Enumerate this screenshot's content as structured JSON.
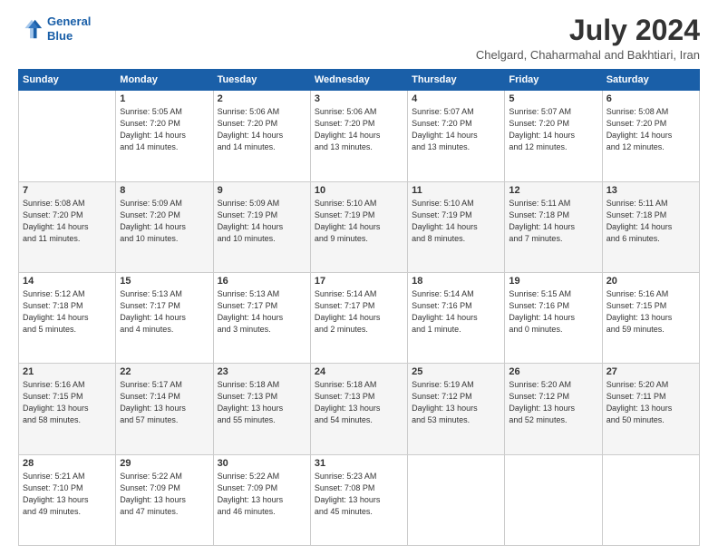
{
  "logo": {
    "line1": "General",
    "line2": "Blue"
  },
  "title": "July 2024",
  "location": "Chelgard, Chaharmahal and Bakhtiari, Iran",
  "headers": [
    "Sunday",
    "Monday",
    "Tuesday",
    "Wednesday",
    "Thursday",
    "Friday",
    "Saturday"
  ],
  "weeks": [
    [
      {
        "day": "",
        "info": ""
      },
      {
        "day": "1",
        "info": "Sunrise: 5:05 AM\nSunset: 7:20 PM\nDaylight: 14 hours\nand 14 minutes."
      },
      {
        "day": "2",
        "info": "Sunrise: 5:06 AM\nSunset: 7:20 PM\nDaylight: 14 hours\nand 14 minutes."
      },
      {
        "day": "3",
        "info": "Sunrise: 5:06 AM\nSunset: 7:20 PM\nDaylight: 14 hours\nand 13 minutes."
      },
      {
        "day": "4",
        "info": "Sunrise: 5:07 AM\nSunset: 7:20 PM\nDaylight: 14 hours\nand 13 minutes."
      },
      {
        "day": "5",
        "info": "Sunrise: 5:07 AM\nSunset: 7:20 PM\nDaylight: 14 hours\nand 12 minutes."
      },
      {
        "day": "6",
        "info": "Sunrise: 5:08 AM\nSunset: 7:20 PM\nDaylight: 14 hours\nand 12 minutes."
      }
    ],
    [
      {
        "day": "7",
        "info": "Sunrise: 5:08 AM\nSunset: 7:20 PM\nDaylight: 14 hours\nand 11 minutes."
      },
      {
        "day": "8",
        "info": "Sunrise: 5:09 AM\nSunset: 7:20 PM\nDaylight: 14 hours\nand 10 minutes."
      },
      {
        "day": "9",
        "info": "Sunrise: 5:09 AM\nSunset: 7:19 PM\nDaylight: 14 hours\nand 10 minutes."
      },
      {
        "day": "10",
        "info": "Sunrise: 5:10 AM\nSunset: 7:19 PM\nDaylight: 14 hours\nand 9 minutes."
      },
      {
        "day": "11",
        "info": "Sunrise: 5:10 AM\nSunset: 7:19 PM\nDaylight: 14 hours\nand 8 minutes."
      },
      {
        "day": "12",
        "info": "Sunrise: 5:11 AM\nSunset: 7:18 PM\nDaylight: 14 hours\nand 7 minutes."
      },
      {
        "day": "13",
        "info": "Sunrise: 5:11 AM\nSunset: 7:18 PM\nDaylight: 14 hours\nand 6 minutes."
      }
    ],
    [
      {
        "day": "14",
        "info": "Sunrise: 5:12 AM\nSunset: 7:18 PM\nDaylight: 14 hours\nand 5 minutes."
      },
      {
        "day": "15",
        "info": "Sunrise: 5:13 AM\nSunset: 7:17 PM\nDaylight: 14 hours\nand 4 minutes."
      },
      {
        "day": "16",
        "info": "Sunrise: 5:13 AM\nSunset: 7:17 PM\nDaylight: 14 hours\nand 3 minutes."
      },
      {
        "day": "17",
        "info": "Sunrise: 5:14 AM\nSunset: 7:17 PM\nDaylight: 14 hours\nand 2 minutes."
      },
      {
        "day": "18",
        "info": "Sunrise: 5:14 AM\nSunset: 7:16 PM\nDaylight: 14 hours\nand 1 minute."
      },
      {
        "day": "19",
        "info": "Sunrise: 5:15 AM\nSunset: 7:16 PM\nDaylight: 14 hours\nand 0 minutes."
      },
      {
        "day": "20",
        "info": "Sunrise: 5:16 AM\nSunset: 7:15 PM\nDaylight: 13 hours\nand 59 minutes."
      }
    ],
    [
      {
        "day": "21",
        "info": "Sunrise: 5:16 AM\nSunset: 7:15 PM\nDaylight: 13 hours\nand 58 minutes."
      },
      {
        "day": "22",
        "info": "Sunrise: 5:17 AM\nSunset: 7:14 PM\nDaylight: 13 hours\nand 57 minutes."
      },
      {
        "day": "23",
        "info": "Sunrise: 5:18 AM\nSunset: 7:13 PM\nDaylight: 13 hours\nand 55 minutes."
      },
      {
        "day": "24",
        "info": "Sunrise: 5:18 AM\nSunset: 7:13 PM\nDaylight: 13 hours\nand 54 minutes."
      },
      {
        "day": "25",
        "info": "Sunrise: 5:19 AM\nSunset: 7:12 PM\nDaylight: 13 hours\nand 53 minutes."
      },
      {
        "day": "26",
        "info": "Sunrise: 5:20 AM\nSunset: 7:12 PM\nDaylight: 13 hours\nand 52 minutes."
      },
      {
        "day": "27",
        "info": "Sunrise: 5:20 AM\nSunset: 7:11 PM\nDaylight: 13 hours\nand 50 minutes."
      }
    ],
    [
      {
        "day": "28",
        "info": "Sunrise: 5:21 AM\nSunset: 7:10 PM\nDaylight: 13 hours\nand 49 minutes."
      },
      {
        "day": "29",
        "info": "Sunrise: 5:22 AM\nSunset: 7:09 PM\nDaylight: 13 hours\nand 47 minutes."
      },
      {
        "day": "30",
        "info": "Sunrise: 5:22 AM\nSunset: 7:09 PM\nDaylight: 13 hours\nand 46 minutes."
      },
      {
        "day": "31",
        "info": "Sunrise: 5:23 AM\nSunset: 7:08 PM\nDaylight: 13 hours\nand 45 minutes."
      },
      {
        "day": "",
        "info": ""
      },
      {
        "day": "",
        "info": ""
      },
      {
        "day": "",
        "info": ""
      }
    ]
  ]
}
